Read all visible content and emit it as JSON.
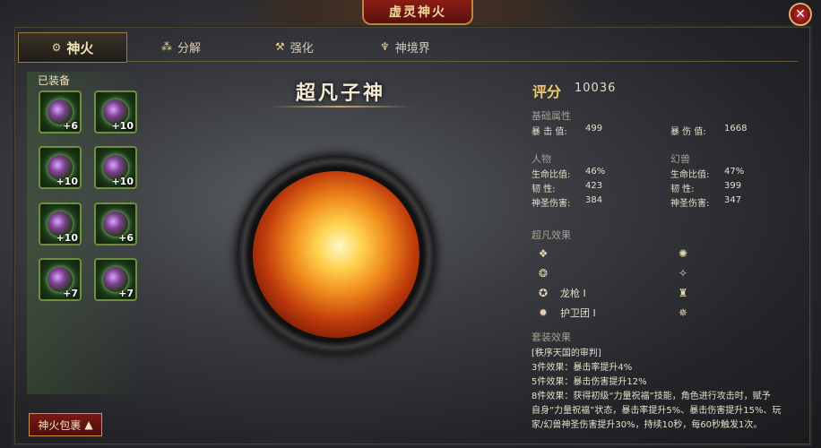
{
  "window": {
    "title": "虚灵神火",
    "close_icon": "close-icon"
  },
  "tabs": [
    {
      "label": "神火",
      "icon": "flame-icon"
    },
    {
      "label": "分解",
      "icon": "scatter-icon"
    },
    {
      "label": "强化",
      "icon": "hammer-icon"
    },
    {
      "label": "神境界",
      "icon": "realm-icon"
    }
  ],
  "equipped": {
    "label": "已装备",
    "slots": [
      {
        "plus": "+6"
      },
      {
        "plus": "+10"
      },
      {
        "plus": "+10"
      },
      {
        "plus": "+10"
      },
      {
        "plus": "+10"
      },
      {
        "plus": "+6"
      },
      {
        "plus": "+7"
      },
      {
        "plus": "+7"
      }
    ]
  },
  "item": {
    "name": "超凡子神"
  },
  "score": {
    "label": "评分",
    "value": "10036"
  },
  "base": {
    "title": "基础属性",
    "crit_label": "暴 击 值:",
    "crit_value": "499",
    "critdmg_label": "暴 伤 值:",
    "critdmg_value": "1668"
  },
  "human": {
    "title": "人物",
    "hp_label": "生命比值:",
    "hp_value": "46%",
    "tough_label": "韧     性:",
    "tough_value": "423",
    "holy_label": "神圣伤害:",
    "holy_value": "384"
  },
  "beast": {
    "title": "幻兽",
    "hp_label": "生命比值:",
    "hp_value": "47%",
    "tough_label": "韧     性:",
    "tough_value": "399",
    "holy_label": "神圣伤害:",
    "holy_value": "347"
  },
  "effects": {
    "title": "超凡效果",
    "dragon_gun": "龙枪 I",
    "guard": "护卫团 I"
  },
  "set": {
    "title": "套装效果",
    "name": "[秩序天国的审判]",
    "line3": "3件效果：暴击率提升4%",
    "line5": "5件效果：暴击伤害提升12%",
    "line8a": "8件效果：获得初级“力量祝福”技能，角色进行攻击时，赋予",
    "line8b": "自身“力量祝福”状态，暴击率提升5%、暴击伤害提升15%、玩",
    "line8c": "家/幻兽神圣伤害提升30%，持续10秒，每60秒触发1次。"
  },
  "bag_button": {
    "label": "神火包裹",
    "icon": "triangle-up-icon"
  }
}
